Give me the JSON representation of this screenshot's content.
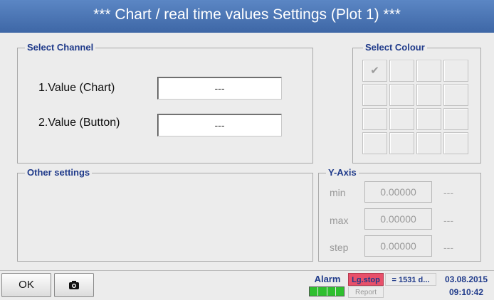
{
  "title": "***   Chart / real time values Settings (Plot 1)   ***",
  "select_channel": {
    "legend": "Select Channel",
    "value1_label": "1.Value (Chart)",
    "value1": "---",
    "value2_label": "2.Value (Button)",
    "value2": "---"
  },
  "select_colour": {
    "legend": "Select Colour",
    "checkmark": "✔"
  },
  "other_settings": {
    "legend": "Other settings"
  },
  "y_axis": {
    "legend": "Y-Axis",
    "min_label": "min",
    "min_value": "0.00000",
    "min_unit": "---",
    "max_label": "max",
    "max_value": "0.00000",
    "max_unit": "---",
    "step_label": "step",
    "step_value": "0.00000",
    "step_unit": "---"
  },
  "bottom": {
    "ok_label": "OK",
    "alarm_label": "Alarm",
    "lgstop_label": "Lg.stop",
    "days_label": "= 1531 d...",
    "report_label": "Report",
    "date": "03.08.2015",
    "time": "09:10:42"
  },
  "colors": {
    "title_bg": "#4a74b4",
    "legend_text": "#1f3a8a",
    "lgstop_bg": "#e8506a",
    "alarm_green": "#2fbf2f"
  }
}
